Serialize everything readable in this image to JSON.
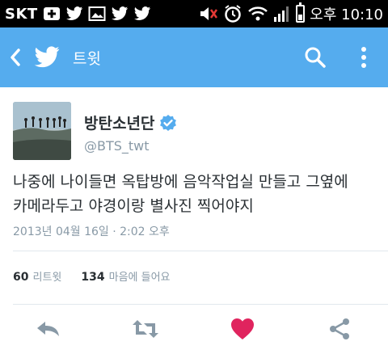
{
  "status_bar": {
    "carrier": "SKT",
    "time": "오후 10:10",
    "icons": [
      "add-icon",
      "twitter-icon",
      "image-icon",
      "twitter-icon",
      "twitter-icon",
      "mute-icon",
      "alarm-icon",
      "wifi-icon",
      "signal-icon",
      "battery-icon"
    ]
  },
  "app_bar": {
    "title": "트윗",
    "color": "#55acee",
    "icons": [
      "back-icon",
      "twitter-logo-icon",
      "search-icon",
      "more-icon"
    ]
  },
  "tweet": {
    "author_name": "방탄소년단",
    "author_handle": "@BTS_twt",
    "verified": true,
    "text_line1": "나중에 나이들면 옥탑방에 음악작업실 만들고 그옆에",
    "text_line2": "카메라두고 야경이랑 별사진 찍어야지",
    "timestamp": "2013년 04월 16일 · 2:02 오후",
    "retweets_count": "60",
    "retweets_label": "리트윗",
    "likes_count": "134",
    "likes_label": "마음에 들어요",
    "actions": [
      "reply-icon",
      "retweet-icon",
      "like-icon",
      "share-icon"
    ],
    "like_color": "#e0245e"
  }
}
